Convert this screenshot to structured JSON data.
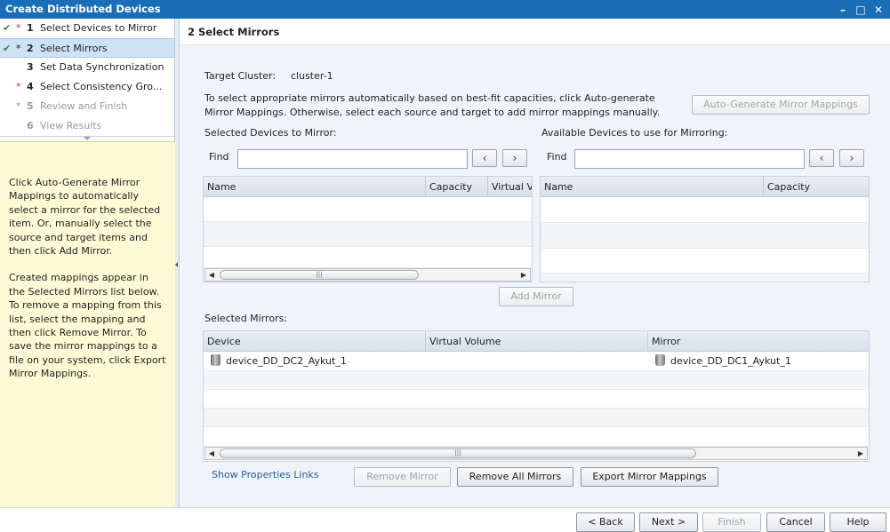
{
  "window": {
    "title": "Create Distributed Devices"
  },
  "steps": [
    {
      "num": "1",
      "label": "Select Devices to Mirror",
      "done": true,
      "required": true,
      "state": "normal"
    },
    {
      "num": "2",
      "label": "Select Mirrors",
      "done": true,
      "required": true,
      "state": "selected"
    },
    {
      "num": "3",
      "label": "Set Data Synchronization",
      "done": false,
      "required": false,
      "state": "normal"
    },
    {
      "num": "4",
      "label": "Select Consistency Gro...",
      "done": false,
      "required": true,
      "state": "normal"
    },
    {
      "num": "5",
      "label": "Review and Finish",
      "done": false,
      "required": true,
      "state": "disabled"
    },
    {
      "num": "6",
      "label": "View Results",
      "done": false,
      "required": false,
      "state": "disabled"
    }
  ],
  "help": {
    "p1": "Click Auto-Generate Mirror Mappings to automatically select a mirror for the selected item.  Or, manually select the source and target items and then click Add Mirror.",
    "p2": "Created mappings appear in the Selected Mirrors list below. To remove a mapping from this list, select the mapping and then click Remove Mirror.  To save the mirror mappings to a file on your system, click Export Mirror Mappings."
  },
  "page": {
    "heading": "2  Select Mirrors",
    "target_cluster_label": "Target Cluster:",
    "target_cluster_value": "cluster-1",
    "instructions": "To select appropriate mirrors automatically based on best-fit capacities, click Auto-generate Mirror Mappings. Otherwise, select each source and target to add mirror mappings manually.",
    "auto_generate_label": "Auto-Generate Mirror Mappings"
  },
  "source": {
    "title": "Selected Devices to Mirror:",
    "find_label": "Find",
    "find_value": "",
    "columns": [
      "Name",
      "Capacity",
      "Virtual V"
    ]
  },
  "available": {
    "title": "Available Devices to use for Mirroring:",
    "find_label": "Find",
    "find_value": "",
    "columns": [
      "Name",
      "Capacity"
    ]
  },
  "add_mirror_label": "Add Mirror",
  "mirrors": {
    "title": "Selected Mirrors:",
    "columns": [
      "Device",
      "Virtual Volume",
      "Mirror"
    ],
    "rows": [
      {
        "device": "device_DD_DC2_Aykut_1",
        "virtual_volume": "",
        "mirror": "device_DD_DC1_Aykut_1"
      }
    ]
  },
  "actions": {
    "show_properties": "Show Properties Links",
    "remove_mirror": "Remove Mirror",
    "remove_all": "Remove All Mirrors",
    "export": "Export Mirror Mappings"
  },
  "footer": {
    "back": "< Back",
    "next": "Next >",
    "finish": "Finish",
    "cancel": "Cancel",
    "help": "Help"
  },
  "icons": {
    "minimize": "minimize-icon",
    "restore": "restore-icon",
    "close": "close-icon",
    "prev": "chevron-left-icon",
    "next": "chevron-right-icon",
    "device": "storage-device-icon"
  },
  "colors": {
    "titlebar": "#1a6eb6",
    "help_bg": "#fdfbd6",
    "check": "#2e8b2e",
    "required": "#dd2222",
    "link": "#1f5fa5"
  }
}
